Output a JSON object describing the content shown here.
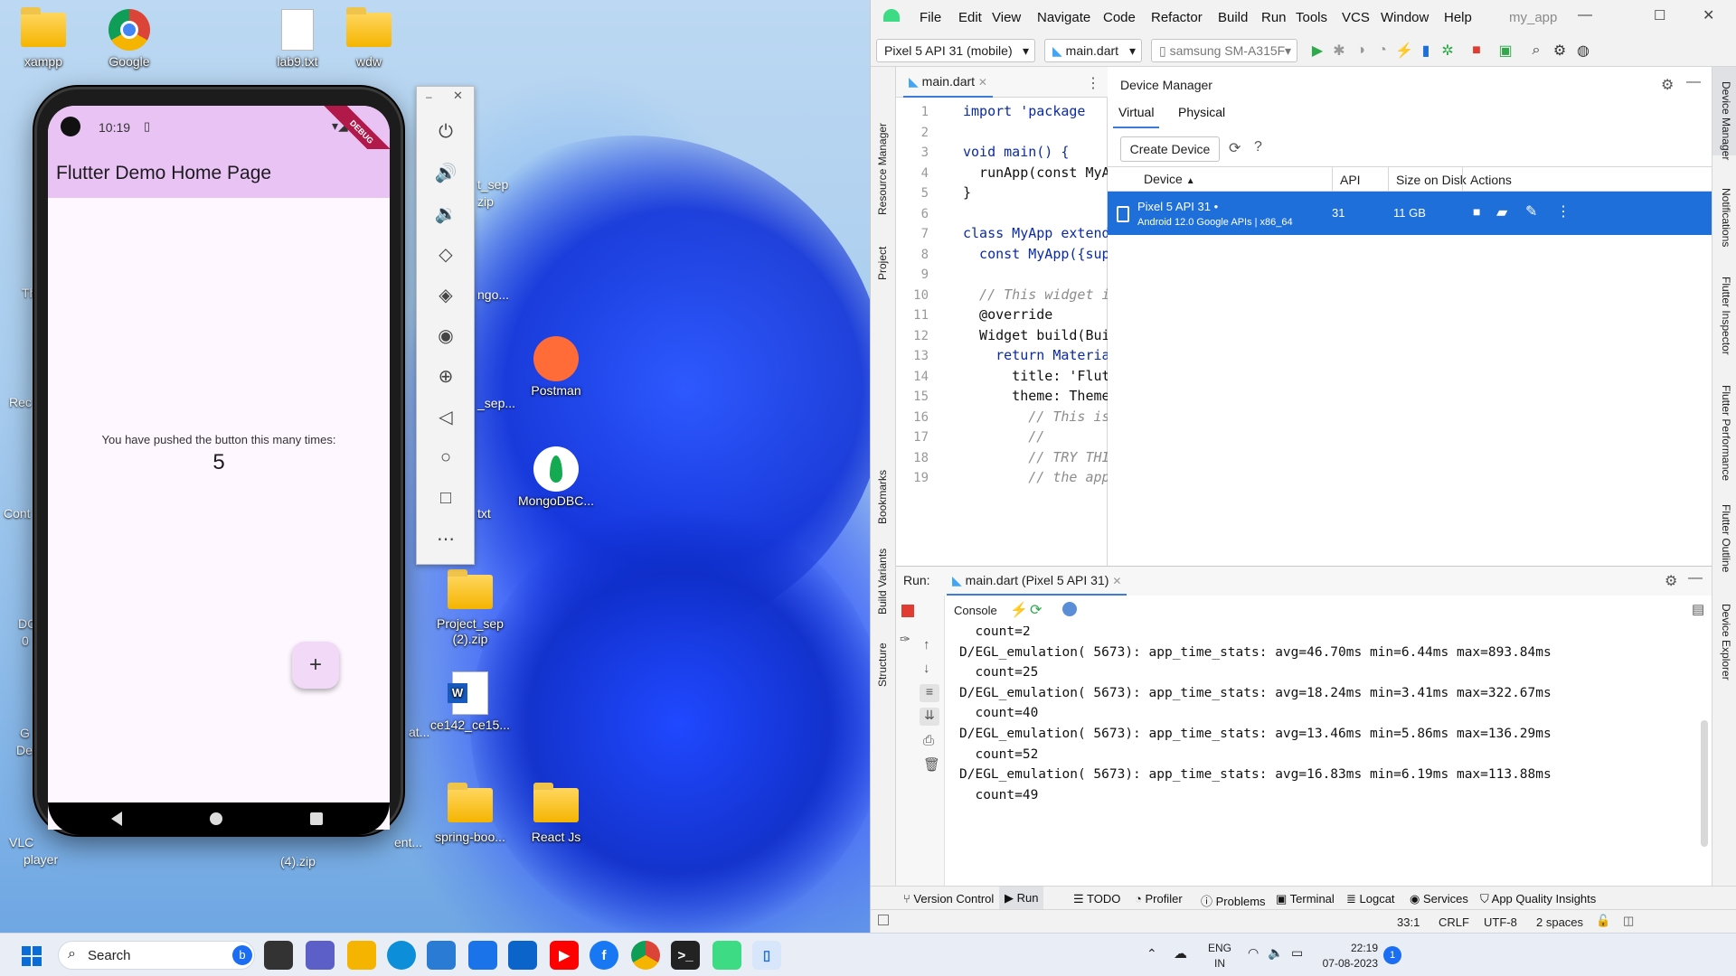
{
  "desktop": {
    "icons": [
      {
        "label": "xampp"
      },
      {
        "label": "Google"
      },
      {
        "label": "lab9.txt"
      },
      {
        "label": "wdw"
      },
      {
        "label": "Postman"
      },
      {
        "label": "MongoDBC..."
      },
      {
        "label": "Project_sep\n(2).zip"
      },
      {
        "label": "ce142_ce15..."
      },
      {
        "label": "spring-boo..."
      },
      {
        "label": "React Js"
      }
    ],
    "partial_labels": [
      "t_sep",
      "zip",
      "ngo...",
      "_sep...",
      "txt",
      "at...",
      "ent...",
      "(4).zip",
      "Th",
      "Rec",
      "Cont",
      "DC",
      "0",
      "G",
      "De",
      "VLC",
      "player"
    ]
  },
  "emulator": {
    "status_time": "10:19",
    "debug_label": "DEBUG",
    "appbar_title": "Flutter Demo Home Page",
    "body_text": "You have pushed the button this many times:",
    "counter": "5",
    "fab_label": "+",
    "toolbar_controls": [
      "power-icon",
      "volume-up-icon",
      "volume-down-icon",
      "rotate-left-icon",
      "rotate-right-icon",
      "screenshot-icon",
      "zoom-icon",
      "back-icon",
      "home-icon",
      "overview-icon",
      "more-icon"
    ]
  },
  "ide": {
    "menu": [
      "File",
      "Edit",
      "View",
      "Navigate",
      "Code",
      "Refactor",
      "Build",
      "Run",
      "Tools",
      "VCS",
      "Window",
      "Help"
    ],
    "project_name": "my_app",
    "toolbar": {
      "device_select": "Pixel 5 API 31 (mobile)",
      "config_select": "main.dart",
      "physical_device": "samsung SM-A315F"
    },
    "left_strip": [
      "Resource Manager",
      "Project",
      "Bookmarks",
      "Build Variants",
      "Structure"
    ],
    "right_strip": [
      "Device Manager",
      "Notifications",
      "Flutter Inspector",
      "Flutter Performance",
      "Flutter Outline",
      "Device Explorer"
    ],
    "editor": {
      "tab": "main.dart",
      "line_numbers": [
        "1",
        "2",
        "3",
        "4",
        "5",
        "6",
        "7",
        "8",
        "9",
        "10",
        "11",
        "12",
        "13",
        "14",
        "15",
        "16",
        "17",
        "18",
        "19"
      ],
      "lines": [
        "import 'package",
        "",
        "void main() {",
        "  runApp(const MyA",
        "}",
        "",
        "class MyApp extend",
        "  const MyApp({sup",
        "",
        "  // This widget i",
        "  @override",
        "  Widget build(Bui",
        "    return Materia",
        "      title: 'Flut",
        "      theme: Theme",
        "        // This is",
        "        //",
        "        // TRY THI",
        "        // the app"
      ]
    },
    "device_manager": {
      "title": "Device Manager",
      "tabs": [
        "Virtual",
        "Physical"
      ],
      "create_button": "Create Device",
      "help": "?",
      "columns": [
        "Device",
        "API",
        "Size on Disk",
        "Actions"
      ],
      "rows": [
        {
          "name": "Pixel 5 API 31",
          "detail": "Android 12.0 Google APIs | x86_64",
          "api": "31",
          "size": "11 GB"
        }
      ]
    },
    "run": {
      "label": "Run:",
      "tab": "main.dart (Pixel 5 API 31)",
      "console_label": "Console",
      "log_lines": [
        "  count=2",
        "D/EGL_emulation( 5673): app_time_stats: avg=46.70ms min=6.44ms max=893.84ms",
        "  count=25",
        "D/EGL_emulation( 5673): app_time_stats: avg=18.24ms min=3.41ms max=322.67ms",
        "  count=40",
        "D/EGL_emulation( 5673): app_time_stats: avg=13.46ms min=5.86ms max=136.29ms",
        "  count=52",
        "D/EGL_emulation( 5673): app_time_stats: avg=16.83ms min=6.19ms max=113.88ms",
        "  count=49"
      ]
    },
    "bottom_tabs": [
      "Version Control",
      "Run",
      "TODO",
      "Profiler",
      "Problems",
      "Terminal",
      "Logcat",
      "Services",
      "App Quality Insights"
    ],
    "status": {
      "position": "33:1",
      "line_sep": "CRLF",
      "encoding": "UTF-8",
      "indent": "2 spaces"
    }
  },
  "taskbar": {
    "search_placeholder": "Search",
    "lang_top": "ENG",
    "lang_bottom": "IN",
    "time": "22:19",
    "date": "07-08-2023",
    "notification_count": "1"
  },
  "colors": {
    "accent": "#1e6fd9",
    "appbar": "#e8c3f3",
    "debug": "#b0194a"
  }
}
